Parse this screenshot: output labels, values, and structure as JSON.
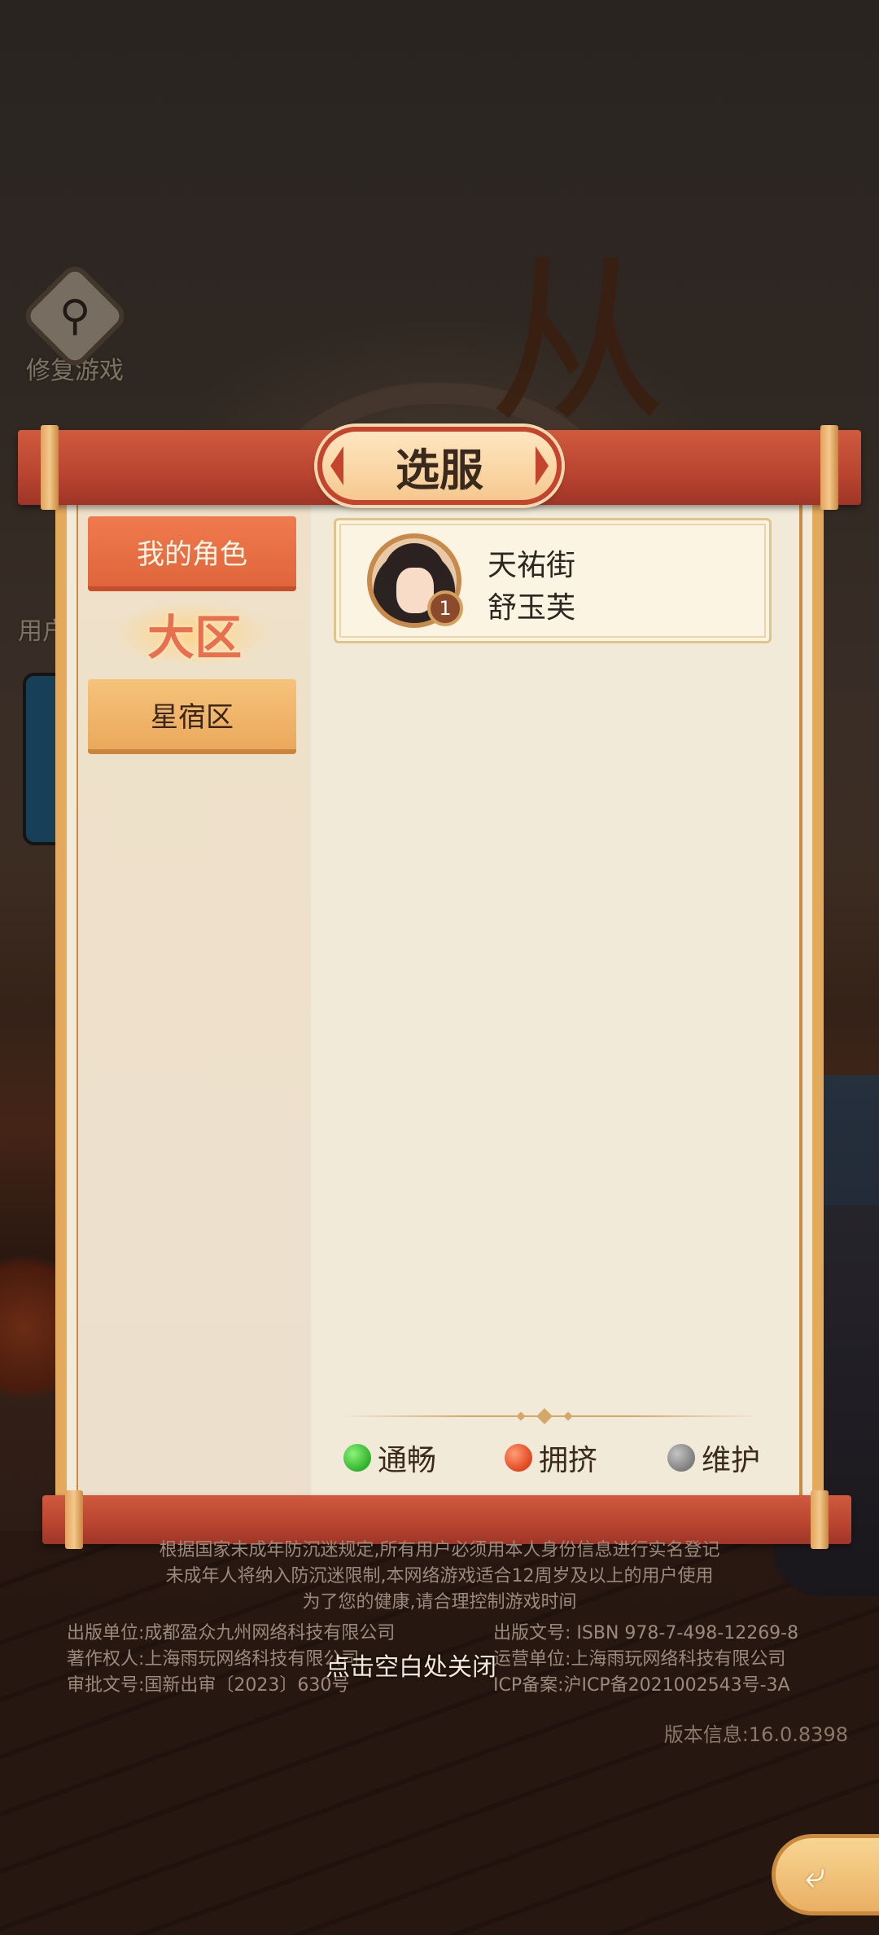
{
  "panel": {
    "title": "选服",
    "tabs": {
      "my_roles": "我的角色",
      "region_header": "大区",
      "xingxiu": "星宿区"
    },
    "role_card": {
      "server_name": "天祐街",
      "character_name": "舒玉芙",
      "level": "1"
    },
    "legend": [
      {
        "label": "通畅",
        "color": "#3cc43a"
      },
      {
        "label": "拥挤",
        "color": "#e85a2c"
      },
      {
        "label": "维护",
        "color": "#8d8d8d"
      }
    ]
  },
  "side_menu": {
    "repair": "修复游戏",
    "user_partial": "用户"
  },
  "background": {
    "logo_char": "从"
  },
  "footer": {
    "notice_lines": [
      "根据国家未成年防沉迷规定,所有用户必须用本人身份信息进行实名登记",
      "未成年人将纳入防沉迷限制,本网络游戏适合12周岁及以上的用户使用",
      "为了您的健康,请合理控制游戏时间"
    ],
    "publisher": "出版单位:成都盈众九州网络科技有限公司",
    "copyright_owner": "著作权人:上海雨玩网络科技有限公司",
    "approval_no": "审批文号:国新出审〔2023〕630号",
    "isbn": "出版文号: ISBN 978-7-498-12269-8",
    "operator": "运营单位:上海雨玩网络科技有限公司",
    "icp": "ICP备案:沪ICP备2021002543号-3A",
    "close_hint": "点击空白处关闭",
    "version": "版本信息:16.0.8398"
  },
  "icons": {
    "repair": "magnifier-wrench-icon",
    "back": "return-arrow-icon"
  }
}
